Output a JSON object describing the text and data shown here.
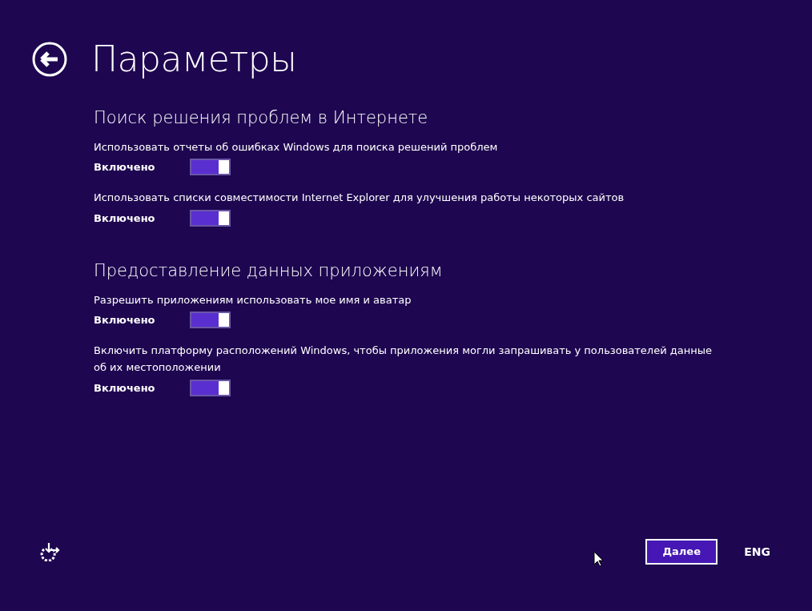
{
  "header": {
    "title": "Параметры"
  },
  "sections": [
    {
      "heading": "Поиск решения проблем в Интернете",
      "settings": [
        {
          "label": "Использовать отчеты об ошибках Windows для поиска решений проблем",
          "state_text": "Включено",
          "on": true
        },
        {
          "label": "Использовать списки совместимости Internet Explorer для улучшения работы некоторых сайтов",
          "state_text": "Включено",
          "on": true
        }
      ]
    },
    {
      "heading": "Предоставление данных приложениям",
      "settings": [
        {
          "label": "Разрешить приложениям использовать мое имя и аватар",
          "state_text": "Включено",
          "on": true
        },
        {
          "label": "Включить платформу расположений Windows, чтобы приложения могли запрашивать у пользователей данные об их местоположении",
          "state_text": "Включено",
          "on": true
        }
      ]
    }
  ],
  "footer": {
    "next_button": "Далее",
    "language": "ENG"
  }
}
